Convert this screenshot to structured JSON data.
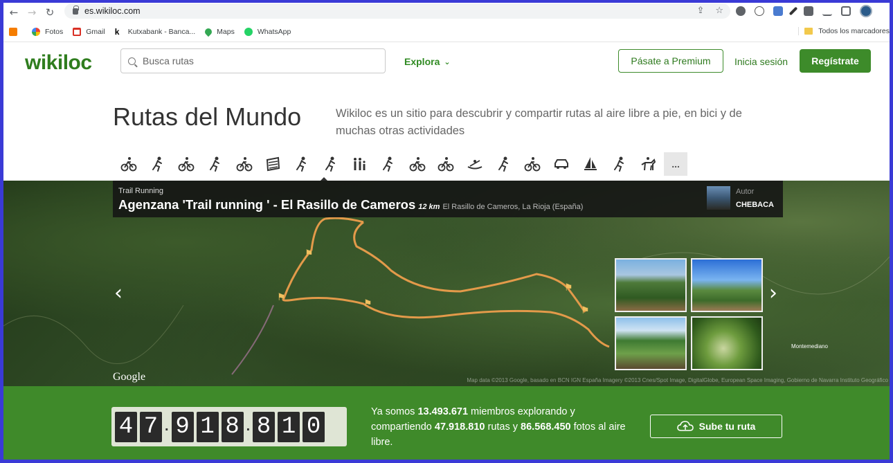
{
  "browser": {
    "url": "es.wikiloc.com",
    "bookmarks": [
      "Fotos",
      "Gmail",
      "Kutxabank - Banca...",
      "Maps",
      "WhatsApp"
    ],
    "bookmarks_right": "Todos los marcadores"
  },
  "header": {
    "logo": "wikiloc",
    "search_placeholder": "Busca rutas",
    "explore_label": "Explora",
    "premium_label": "Pásate a Premium",
    "login_label": "Inicia sesión",
    "signup_label": "Regístrate"
  },
  "hero": {
    "title": "Rutas del Mundo",
    "description": "Wikiloc es un sitio para descubrir y compartir rutas al aire libre a pie, en bici y de muchas otras actividades",
    "activities": [
      "mountain-biking-icon",
      "hiking-icon",
      "cycling-icon",
      "running-icon",
      "mountain-bike-icon",
      "via-ferrata-icon",
      "climbing-icon",
      "trail-running-icon",
      "family-walk-icon",
      "ski-touring-icon",
      "motorcycle-icon",
      "motocross-icon",
      "kayak-icon",
      "walking-icon",
      "quad-icon",
      "car-icon",
      "sailing-icon",
      "skiing-icon",
      "horseback-icon"
    ],
    "more_label": "..."
  },
  "featured": {
    "category": "Trail Running",
    "title": "Agenzana 'Trail running ' - El Rasillo de Cameros",
    "distance": "12 km",
    "location": "El Rasillo de Cameros, La Rioja (España)",
    "author_label": "Autor",
    "author": "CHEBACA",
    "google": "Google",
    "attribution": "Map data ©2013 Google, basado en BCN IGN España Imagery ©2013 Cnes/Spot Image, DigitalGlobe, European Space Imaging, Gobierno de Navarra Instituto Geográfico",
    "place": "Montemediano"
  },
  "stats": {
    "counter_digits": [
      "4",
      "7",
      ".",
      "9",
      "1",
      "8",
      ".",
      "8",
      "1",
      "0"
    ],
    "text_1": "Ya somos ",
    "members": "13.493.671",
    "text_2": " miembros explorando y compartiendo ",
    "routes": "47.918.810",
    "text_3": " rutas y ",
    "photos": "86.568.450",
    "text_4": " fotos al aire libre.",
    "upload_label": "Sube tu ruta"
  },
  "colors": {
    "brand_green": "#3f8a2a",
    "logo_green": "#2f7d1e"
  }
}
